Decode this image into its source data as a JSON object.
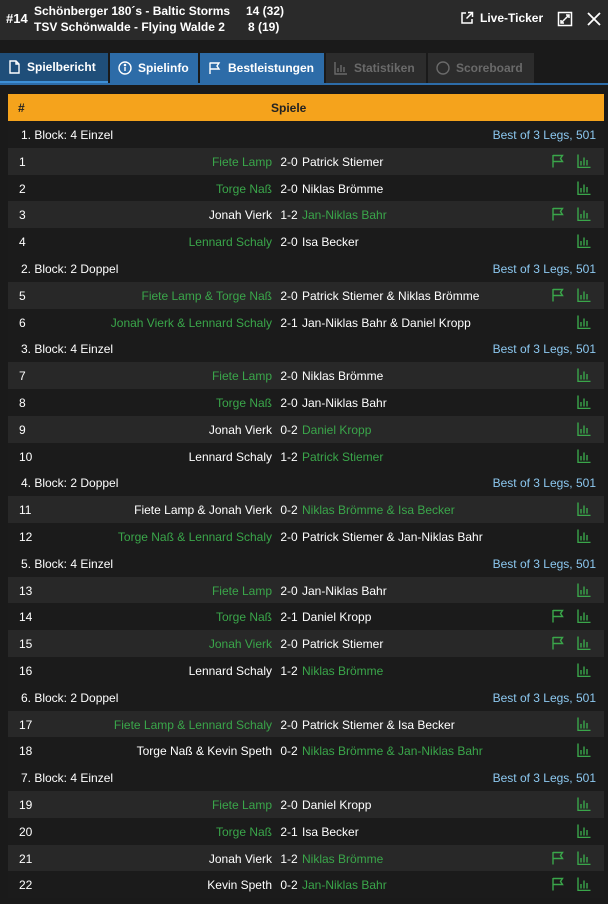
{
  "header": {
    "match_number": "#14",
    "team1": "Schönberger 180´s - Baltic Storms",
    "team2": "TSV Schönwalde - Flying Walde 2",
    "score1": "14  (32)",
    "score2": "8  (19)",
    "live_ticker_label": "Live-Ticker"
  },
  "tabs": [
    {
      "label": "Spielbericht",
      "icon": "document-icon",
      "state": "active"
    },
    {
      "label": "Spielinfo",
      "icon": "info-icon",
      "state": "normal"
    },
    {
      "label": "Bestleistungen",
      "icon": "flag-icon",
      "state": "normal"
    },
    {
      "label": "Statistiken",
      "icon": "bar-chart-icon",
      "state": "disabled"
    },
    {
      "label": "Scoreboard",
      "icon": "circle-icon",
      "state": "disabled"
    }
  ],
  "table": {
    "col_num": "#",
    "col_games": "Spiele",
    "rows": [
      {
        "type": "block",
        "label": "1. Block: 4 Einzel",
        "best_of": "Best of 3 Legs, 501"
      },
      {
        "type": "game",
        "n": "1",
        "home": "Fiete Lamp",
        "score": "2-0",
        "away": "Patrick Stiemer",
        "winner": "home",
        "flag": true
      },
      {
        "type": "game",
        "n": "2",
        "home": "Torge Naß",
        "score": "2-0",
        "away": "Niklas Brömme",
        "winner": "home",
        "flag": false
      },
      {
        "type": "game",
        "n": "3",
        "home": "Jonah Vierk",
        "score": "1-2",
        "away": "Jan-Niklas Bahr",
        "winner": "away",
        "flag": true
      },
      {
        "type": "game",
        "n": "4",
        "home": "Lennard Schaly",
        "score": "2-0",
        "away": "Isa Becker",
        "winner": "home",
        "flag": false
      },
      {
        "type": "block",
        "label": "2. Block: 2 Doppel",
        "best_of": "Best of 3 Legs, 501"
      },
      {
        "type": "game",
        "n": "5",
        "home": "Fiete Lamp & Torge Naß",
        "score": "2-0",
        "away": "Patrick Stiemer & Niklas Brömme",
        "winner": "home",
        "flag": true
      },
      {
        "type": "game",
        "n": "6",
        "home": "Jonah Vierk & Lennard Schaly",
        "score": "2-1",
        "away": "Jan-Niklas Bahr & Daniel Kropp",
        "winner": "home",
        "flag": false
      },
      {
        "type": "block",
        "label": "3. Block: 4 Einzel",
        "best_of": "Best of 3 Legs, 501"
      },
      {
        "type": "game",
        "n": "7",
        "home": "Fiete Lamp",
        "score": "2-0",
        "away": "Niklas Brömme",
        "winner": "home",
        "flag": false
      },
      {
        "type": "game",
        "n": "8",
        "home": "Torge Naß",
        "score": "2-0",
        "away": "Jan-Niklas Bahr",
        "winner": "home",
        "flag": false
      },
      {
        "type": "game",
        "n": "9",
        "home": "Jonah Vierk",
        "score": "0-2",
        "away": "Daniel Kropp",
        "winner": "away",
        "flag": false
      },
      {
        "type": "game",
        "n": "10",
        "home": "Lennard Schaly",
        "score": "1-2",
        "away": "Patrick Stiemer",
        "winner": "away",
        "flag": false
      },
      {
        "type": "block",
        "label": "4. Block: 2 Doppel",
        "best_of": "Best of 3 Legs, 501"
      },
      {
        "type": "game",
        "n": "11",
        "home": "Fiete Lamp & Jonah Vierk",
        "score": "0-2",
        "away": "Niklas Brömme & Isa Becker",
        "winner": "away",
        "flag": false
      },
      {
        "type": "game",
        "n": "12",
        "home": "Torge Naß & Lennard Schaly",
        "score": "2-0",
        "away": "Patrick Stiemer & Jan-Niklas Bahr",
        "winner": "home",
        "flag": false
      },
      {
        "type": "block",
        "label": "5. Block: 4 Einzel",
        "best_of": "Best of 3 Legs, 501"
      },
      {
        "type": "game",
        "n": "13",
        "home": "Fiete Lamp",
        "score": "2-0",
        "away": "Jan-Niklas Bahr",
        "winner": "home",
        "flag": false
      },
      {
        "type": "game",
        "n": "14",
        "home": "Torge Naß",
        "score": "2-1",
        "away": "Daniel Kropp",
        "winner": "home",
        "flag": true
      },
      {
        "type": "game",
        "n": "15",
        "home": "Jonah Vierk",
        "score": "2-0",
        "away": "Patrick Stiemer",
        "winner": "home",
        "flag": true
      },
      {
        "type": "game",
        "n": "16",
        "home": "Lennard Schaly",
        "score": "1-2",
        "away": "Niklas Brömme",
        "winner": "away",
        "flag": false
      },
      {
        "type": "block",
        "label": "6. Block: 2 Doppel",
        "best_of": "Best of 3 Legs, 501"
      },
      {
        "type": "game",
        "n": "17",
        "home": "Fiete Lamp & Lennard Schaly",
        "score": "2-0",
        "away": "Patrick Stiemer & Isa Becker",
        "winner": "home",
        "flag": false
      },
      {
        "type": "game",
        "n": "18",
        "home": "Torge Naß & Kevin Speth",
        "score": "0-2",
        "away": "Niklas Brömme & Jan-Niklas Bahr",
        "winner": "away",
        "flag": false
      },
      {
        "type": "block",
        "label": "7. Block: 4 Einzel",
        "best_of": "Best of 3 Legs, 501"
      },
      {
        "type": "game",
        "n": "19",
        "home": "Fiete Lamp",
        "score": "2-0",
        "away": "Daniel Kropp",
        "winner": "home",
        "flag": false
      },
      {
        "type": "game",
        "n": "20",
        "home": "Torge Naß",
        "score": "2-1",
        "away": "Isa Becker",
        "winner": "home",
        "flag": false
      },
      {
        "type": "game",
        "n": "21",
        "home": "Jonah Vierk",
        "score": "1-2",
        "away": "Niklas Brömme",
        "winner": "away",
        "flag": true
      },
      {
        "type": "game",
        "n": "22",
        "home": "Kevin Speth",
        "score": "0-2",
        "away": "Jan-Niklas Bahr",
        "winner": "away",
        "flag": true
      }
    ]
  },
  "colors": {
    "accent_orange": "#f5a31c",
    "tab_blue": "#2d6ca8",
    "winner_green": "#3aa64a",
    "best_of_blue": "#8cc8f0"
  }
}
